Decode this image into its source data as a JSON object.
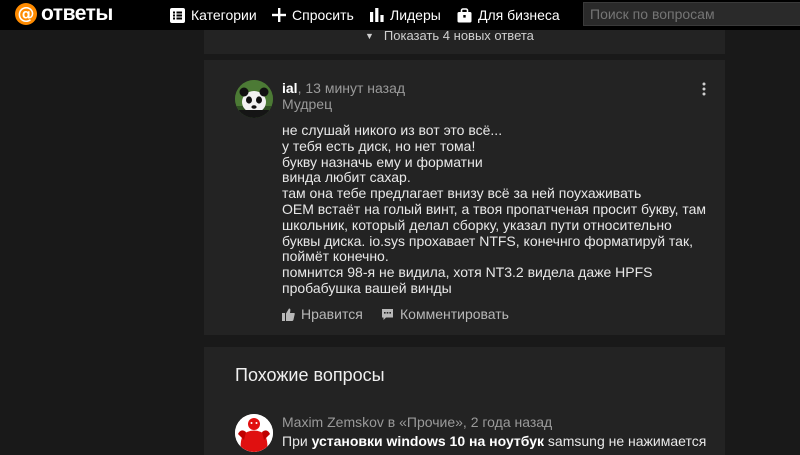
{
  "header": {
    "logo_text": "ответы",
    "logo_symbol": "@",
    "nav": [
      {
        "label": "Категории",
        "icon": "list-icon"
      },
      {
        "label": "Спросить",
        "icon": "plus-icon"
      },
      {
        "label": "Лидеры",
        "icon": "bar-chart-icon"
      },
      {
        "label": "Для бизнеса",
        "icon": "briefcase-icon"
      }
    ],
    "search_placeholder": "Поиск по вопросам"
  },
  "feed": {
    "show_more_label": "Показать 4 новых ответа"
  },
  "answer": {
    "author": "ial",
    "time": ", 13 минут назад",
    "rank": "Мудрец",
    "lines": [
      "не слушай никого из вот это всё...",
      "у тебя есть диск, но нет тома!",
      "букву назначь ему и форматни",
      "винда любит сахар.",
      "там она тебе предлагает внизу всё за ней поухаживать",
      "OEM встаёт на голый винт, а твоя пропатченая просит букву, там",
      "школьник, который делал сборку, указал пути относительно",
      "буквы диска. io.sys прохавает NTFS, конечнго форматируй так,",
      "поймёт конечно.",
      "помнится 98-я не видила, хотя NT3.2 видела даже HPFS",
      "пробабушка вашей винды"
    ],
    "like_label": "Нравится",
    "comment_label": "Комментировать"
  },
  "similar": {
    "title": "Похожие вопросы",
    "items": [
      {
        "author": "Maxim Zemskov",
        "meta": "Maxim Zemskov в «Прочие», 2 года назад",
        "text_pre": "При ",
        "text_bold": "установки windows 10 на ноутбук",
        "text_post": " samsung не нажимается"
      }
    ]
  },
  "colors": {
    "accent": "#ff8b00",
    "background": "#191919",
    "card": "#232323",
    "topbar": "#000000"
  }
}
